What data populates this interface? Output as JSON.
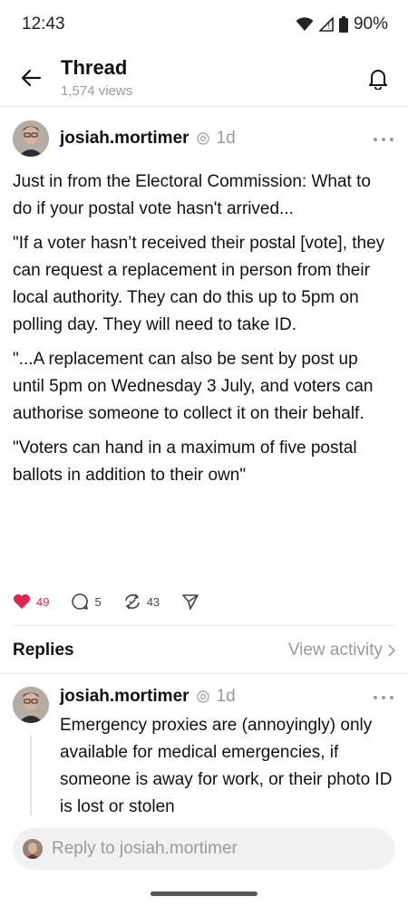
{
  "status_bar": {
    "time": "12:43",
    "battery": "90%",
    "icons": [
      "wifi-icon",
      "signal-icon",
      "battery-icon"
    ]
  },
  "header": {
    "title": "Thread",
    "views": "1,574 views",
    "icons": [
      "back-arrow-icon",
      "bell-icon"
    ]
  },
  "post": {
    "author": "josiah.mortimer",
    "time": "1d",
    "paragraphs": [
      "Just in from the Electoral Commission: What to do if your postal vote hasn't arrived...",
      "\"If a voter hasn’t received their postal [vote], they can request a replacement in person from their local authority. They can do this up to 5pm on polling day. They will need to take ID.",
      "\"...A replacement can also be sent by post up until 5pm on Wednesday 3 July, and voters can authorise someone to collect it on their behalf.",
      "\"Voters can hand in a maximum of five postal ballots in addition to their own\""
    ],
    "likes": "49",
    "comments": "5",
    "reposts": "43",
    "liked_color": "#e0244a"
  },
  "replies_section": {
    "label": "Replies",
    "view_activity": "View activity"
  },
  "reply": {
    "author": "josiah.mortimer",
    "time": "1d",
    "text": "Emergency proxies are (annoyingly) only available for medical emergencies, if someone is away for work, or their photo ID is lost or stolen"
  },
  "reply_bar": {
    "placeholder": "Reply to josiah.mortimer"
  }
}
